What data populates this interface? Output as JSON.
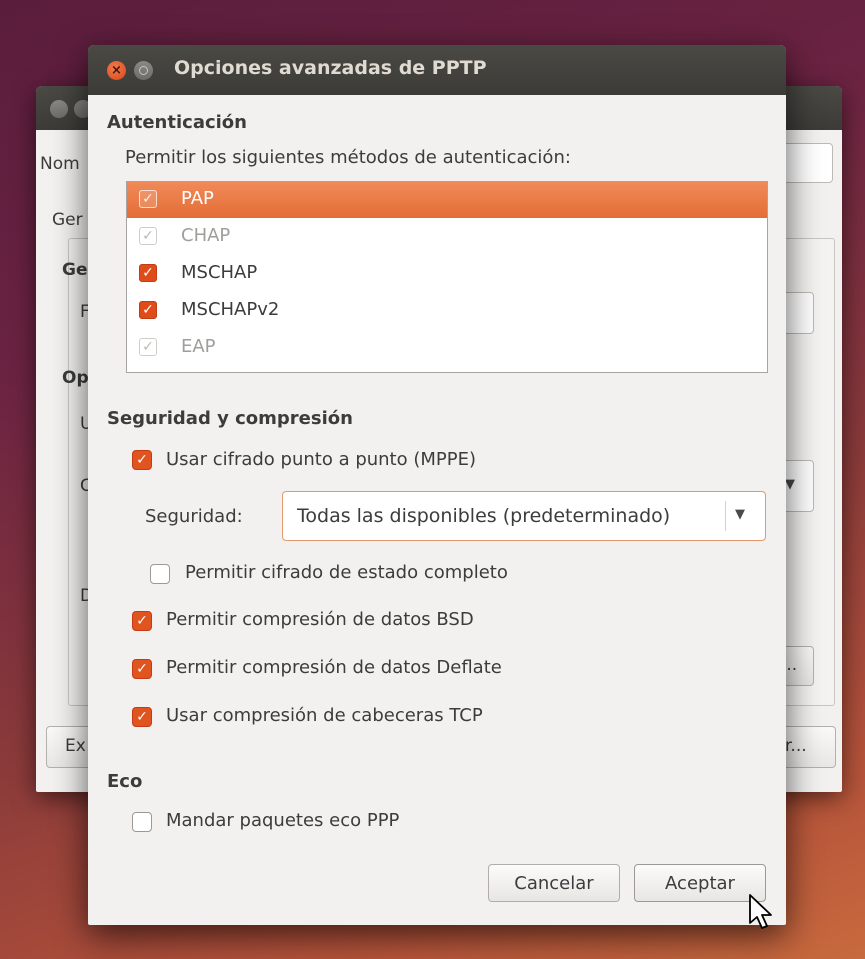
{
  "background_window": {
    "name_label": "Nom",
    "general_tab": "Ger",
    "general_heading": "Ge",
    "field_letter": "F",
    "options_heading": "Op",
    "letter_u": "U",
    "letter_c": "C",
    "letter_d": "D",
    "dots_button": "...",
    "export_button": "Ex",
    "right_button": "r..."
  },
  "dialog": {
    "title": "Opciones avanzadas de PPTP",
    "close_glyph": "×",
    "auth": {
      "heading": "Autenticación",
      "prompt": "Permitir los siguientes métodos de autenticación:",
      "methods": [
        {
          "label": "PAP",
          "checked": true,
          "enabled": false,
          "selected": true
        },
        {
          "label": "CHAP",
          "checked": true,
          "enabled": false,
          "selected": false
        },
        {
          "label": "MSCHAP",
          "checked": true,
          "enabled": true,
          "selected": false
        },
        {
          "label": "MSCHAPv2",
          "checked": true,
          "enabled": true,
          "selected": false
        },
        {
          "label": "EAP",
          "checked": true,
          "enabled": false,
          "selected": false
        }
      ]
    },
    "security": {
      "heading": "Seguridad y compresión",
      "mppe_label": "Usar cifrado punto a punto (MPPE)",
      "mppe_checked": true,
      "security_label": "Seguridad:",
      "security_value": "Todas las disponibles (predeterminado)",
      "stateful_label": "Permitir cifrado de estado completo",
      "stateful_checked": false,
      "bsd_label": "Permitir compresión de datos BSD",
      "bsd_checked": true,
      "deflate_label": "Permitir compresión de datos Deflate",
      "deflate_checked": true,
      "tcp_label": "Usar compresión de cabeceras TCP",
      "tcp_checked": true
    },
    "echo": {
      "heading": "Eco",
      "ppp_echo_label": "Mandar paquetes eco PPP",
      "ppp_echo_checked": false
    },
    "buttons": {
      "cancel": "Cancelar",
      "ok": "Aceptar"
    },
    "checkmark_glyph": "✓"
  },
  "colors": {
    "accent": "#e2541f",
    "selection": "#e46d36",
    "titlebar": "#3c3b37"
  }
}
